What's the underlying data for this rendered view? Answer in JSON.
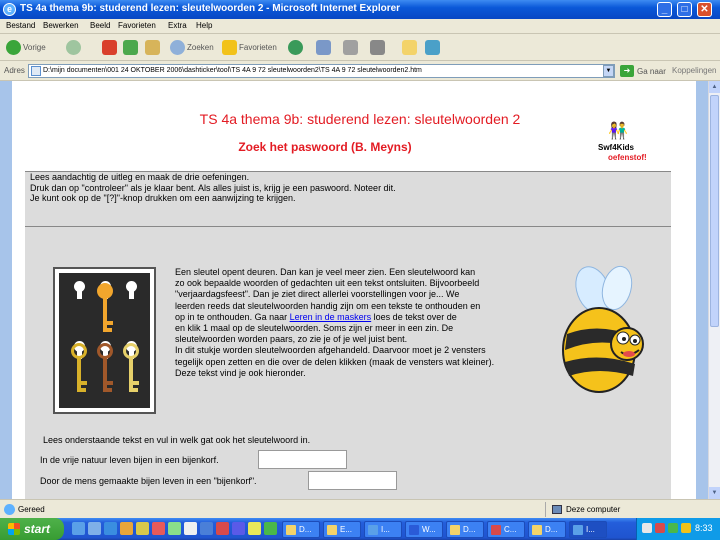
{
  "window": {
    "title": "TS 4a thema 9b: studerend lezen: sleutelwoorden 2 - Microsoft Internet Explorer",
    "buttons": [
      "_",
      "□",
      "✕"
    ]
  },
  "menubar": [
    "Bestand",
    "Bewerken",
    "Beeld",
    "Favorieten",
    "Extra",
    "Help"
  ],
  "toolbar": {
    "back": "Vorige",
    "search": "Zoeken",
    "favorites": "Favorieten"
  },
  "addressbar": {
    "label": "Adres",
    "url": "D:\\mijn documenten\\001 24 OKTOBER 2006\\dashticker\\tool\\TS 4A 9 72 sleutelwoorden2\\TS 4A 9 72 sleutelwoorden2.htm",
    "go": "Ga naar",
    "links": "Koppelingen"
  },
  "page": {
    "title": "TS 4a thema 9b: studerend lezen: sleutelwoorden 2",
    "subtitle": "Zoek het paswoord (B. Meyns)",
    "logo_text": "Swf4Kids",
    "logo_sub": "oefenstof!",
    "instructions": [
      "Lees aandachtig de uitleg en maak de drie oefeningen.",
      "Druk dan op \"controleer\" als je klaar bent. Als alles juist is, krijg je een paswoord. Noteer dit.",
      "Je kunt ook op de \"[?]\"-knop drukken om een aanwijzing te krijgen."
    ],
    "story_lines": [
      "Een sleutel opent deuren. Dan kan je veel meer zien. Een sleutelwoord kan",
      "zo ook bepaalde woorden of gedachten uit een tekst ontsluiten. Bijvoorbeeld",
      "\"verjaardagsfeest\". Dan je ziet direct allerlei voorstellingen voor je... We",
      "leerden reeds dat sleutelwoorden handig zijn om een tekste te onthouden en",
      "op in te onthouden. Ga naar",
      "en klik 1 maal op de sleutelwoorden. Soms zijn er meer in een zin. De",
      "sleutelwoorden worden paars, zo zie je of je wel juist bent.",
      "In dit stukje worden sleutelwoorden afgehandeld. Daarvoor moet je 2 vensters",
      "tegelijk open zetten en die over de delen klikken (maak de vensters wat kleiner).",
      "Deze tekst vind je ook hieronder."
    ],
    "story_link": "Leren in de maskers",
    "story_after_link": "loes de tekst over de",
    "question_intro": "Lees onderstaande tekst en vul in welk gat ook het sleutelwoord in.",
    "q1": "In de vrije natuur leven bijen in een bijenkorf.",
    "q2": "Door de mens gemaakte bijen leven in een \"bijenkorf\"."
  },
  "statusbar": {
    "status": "Gereed",
    "zone": "Deze computer"
  },
  "taskbar": {
    "start": "start",
    "tasks": [
      "D...",
      "E...",
      "I...",
      "W...",
      "D...",
      "C...",
      "D...",
      "I..."
    ],
    "clock": "8:33"
  },
  "colors": {
    "accent_red": "#e31b23",
    "title_blue": "#0a58d8",
    "page_bg": "#a7c4ea"
  }
}
